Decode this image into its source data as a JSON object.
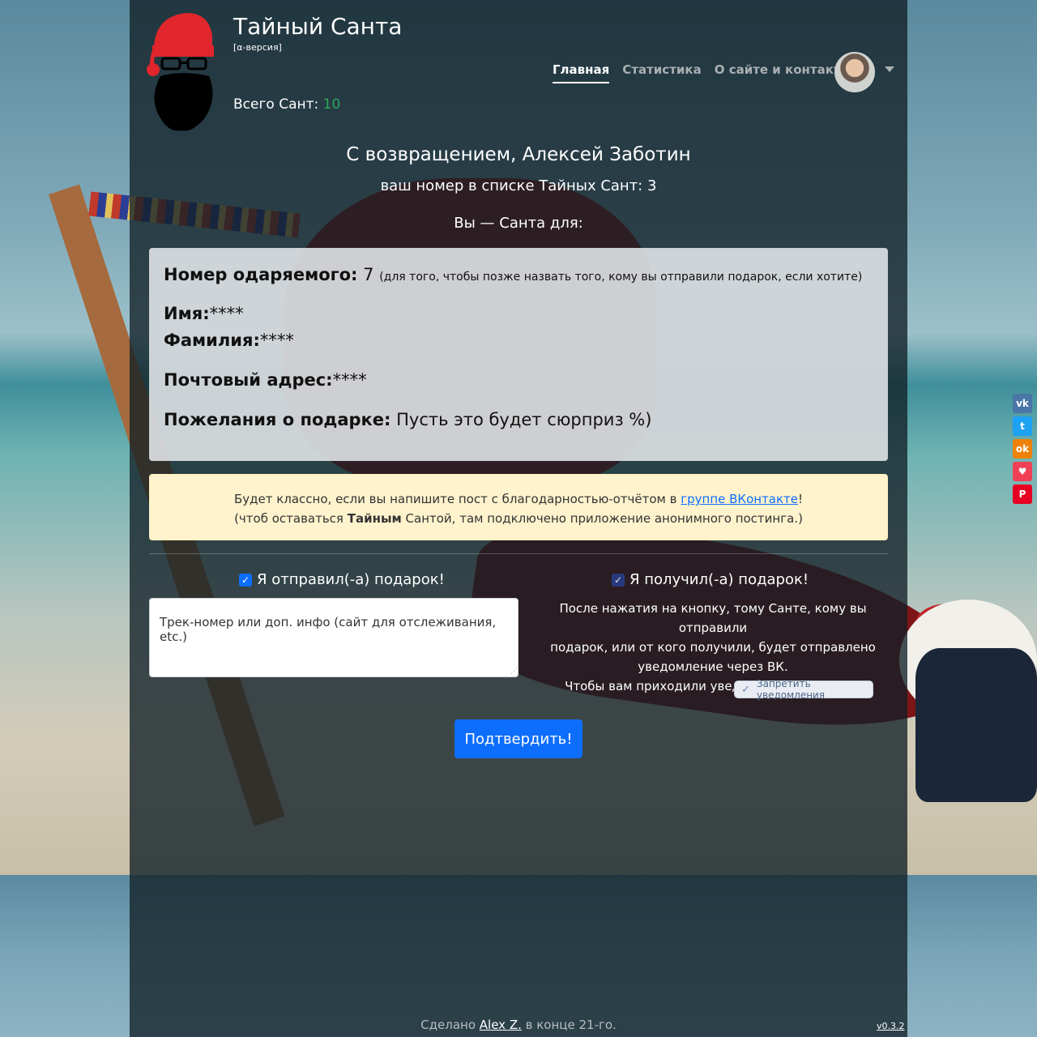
{
  "header": {
    "title": "Тайный Санта",
    "subtitle": "[α-версия]",
    "total_label": "Всего Сант:",
    "total_value": "10"
  },
  "nav": {
    "items": [
      {
        "label": "Главная",
        "active": true
      },
      {
        "label": "Статистика",
        "active": false
      },
      {
        "label": "О сайте и контакты",
        "active": false
      }
    ]
  },
  "welcome": {
    "greeting": "С возвращением, Алексей Заботин",
    "number_line": "ваш номер в списке Тайных Сант: 3",
    "santa_for": "Вы — Санта для:"
  },
  "recipient": {
    "number_label": "Номер одаряемого:",
    "number_value": "7",
    "number_hint": "(для того, чтобы позже назвать того, кому вы отправили подарок, если хотите)",
    "name_label": "Имя:",
    "name_value": "****",
    "surname_label": "Фамилия:",
    "surname_value": "****",
    "address_label": "Почтовый адрес:",
    "address_value": "****",
    "wishes_label": "Пожелания о подарке:",
    "wishes_value": "Пусть это будет сюрприз %)"
  },
  "alert": {
    "line1_before": "Будет классно, если вы напишите пост с благодарностью-отчётом в ",
    "line1_link": "группе ВКонтакте",
    "line1_after": "!",
    "line2_before": "(чтоб оставаться ",
    "line2_bold": "Тайным",
    "line2_after": " Сантой, там подключено приложение анонимного постинга.)"
  },
  "form": {
    "sent_label": "Я отправил(-а) подарок!",
    "sent_checked": true,
    "received_label": "Я получил(-а) подарок!",
    "received_checked": true,
    "track_placeholder": "Трек-номер или доп. инфо (сайт для отслеживания, etc.)",
    "note_lines": [
      "После нажатия на кнопку, тому Санте, кому вы отправили",
      "подарок, или от кого получили, будет отправлено",
      "уведомление через ВК.",
      "Чтобы вам приходили уведомления, нажмите"
    ],
    "vk_button_label": "Запретить уведомления",
    "submit_label": "Подтвердить!"
  },
  "social": [
    "vk-icon",
    "twitter-icon",
    "odnoklassniki-icon",
    "pocket-icon",
    "pinterest-icon"
  ],
  "footer": {
    "before": "Сделано ",
    "author": "Alex Z.",
    "after": " в конце 21-го.",
    "version": "v0.3.2"
  },
  "colors": {
    "accent": "#0d6efd",
    "total_value": "#2fa55d",
    "alert_bg": "#fff3cd"
  }
}
